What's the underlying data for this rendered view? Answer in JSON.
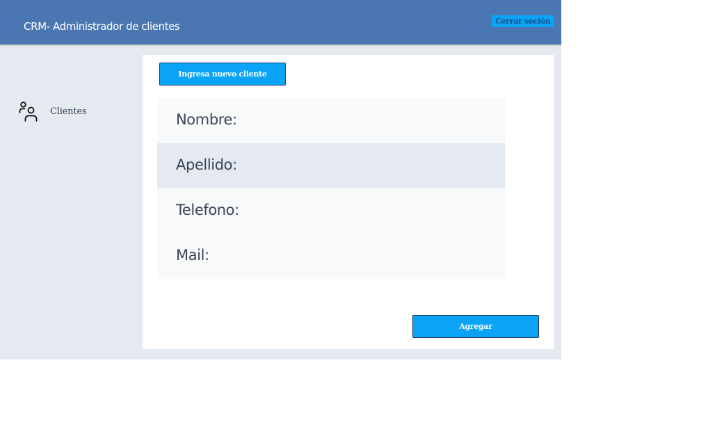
{
  "header": {
    "title": "CRM- Administrador de clientes",
    "logout_label": "Cerrar seción"
  },
  "sidebar": {
    "items": [
      {
        "label": "Clientes",
        "icon": "users-icon"
      }
    ]
  },
  "main": {
    "new_client_label": "Ingresa nuevo cliente",
    "form": {
      "fields": [
        {
          "label": "Nombre:"
        },
        {
          "label": "Apellido:"
        },
        {
          "label": "Telefono:"
        },
        {
          "label": "Mail:"
        }
      ]
    },
    "add_label": "Agregar"
  },
  "colors": {
    "header_bg": "#4a76b2",
    "button_bg": "#0aa3f5",
    "app_bg": "#e5e9f0",
    "row_alt_bg": "#e5e9f2",
    "row_bg": "#f7f9fb"
  }
}
